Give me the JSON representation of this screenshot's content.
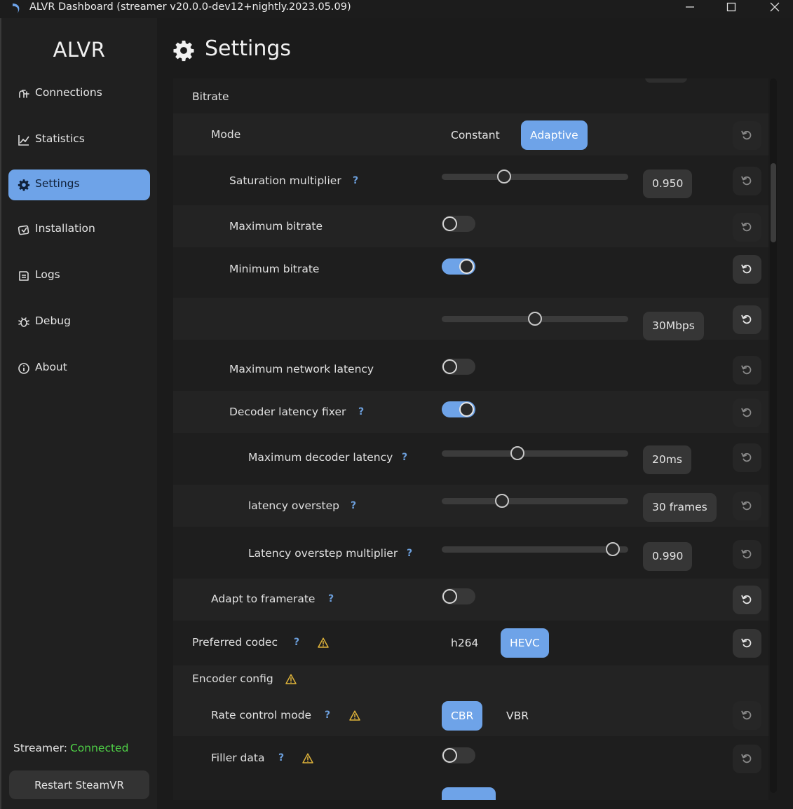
{
  "window": {
    "title": "ALVR Dashboard (streamer v20.0.0-dev12+nightly.2023.05.09)"
  },
  "sidebar": {
    "brand": "ALVR",
    "items": [
      {
        "label": "Connections",
        "icon": "connections-icon",
        "active": false
      },
      {
        "label": "Statistics",
        "icon": "chart-icon",
        "active": false
      },
      {
        "label": "Settings",
        "icon": "gear-icon",
        "active": true
      },
      {
        "label": "Installation",
        "icon": "installation-icon",
        "active": false
      },
      {
        "label": "Logs",
        "icon": "logs-icon",
        "active": false
      },
      {
        "label": "Debug",
        "icon": "debug-icon",
        "active": false
      },
      {
        "label": "About",
        "icon": "info-icon",
        "active": false
      }
    ],
    "streamer_label": "Streamer:",
    "streamer_status": "Connected",
    "restart_label": "Restart SteamVR"
  },
  "header": {
    "title": "Settings"
  },
  "colors": {
    "accent": "#6ea3e8",
    "connected": "#4fd247",
    "warning": "#e0b43a",
    "help": "#6c9fdc"
  },
  "settings": {
    "bitrate": {
      "label": "Bitrate"
    },
    "mode": {
      "label": "Mode",
      "options": [
        "Constant",
        "Adaptive"
      ],
      "selected": "Adaptive"
    },
    "saturation_multiplier": {
      "label": "Saturation multiplier",
      "help": "?",
      "value": "0.950"
    },
    "maximum_bitrate": {
      "label": "Maximum bitrate",
      "enabled": false
    },
    "minimum_bitrate": {
      "label": "Minimum bitrate",
      "enabled": true,
      "value": "30Mbps"
    },
    "maximum_network_latency": {
      "label": "Maximum network latency",
      "enabled": false
    },
    "decoder_latency_fixer": {
      "label": "Decoder latency fixer",
      "help": "?",
      "enabled": true
    },
    "maximum_decoder_latency": {
      "label": "Maximum decoder latency",
      "help": "?",
      "value": "20ms"
    },
    "latency_overstep": {
      "label": "latency overstep",
      "help": "?",
      "value": "30 frames"
    },
    "latency_overstep_multiplier": {
      "label": "Latency overstep multiplier",
      "help": "?",
      "value": "0.990"
    },
    "adapt_to_framerate": {
      "label": "Adapt to framerate",
      "help": "?",
      "enabled": false
    },
    "preferred_codec": {
      "label": "Preferred codec",
      "help": "?",
      "options": [
        "h264",
        "HEVC"
      ],
      "selected": "HEVC"
    },
    "encoder_config": {
      "label": "Encoder config"
    },
    "rate_control_mode": {
      "label": "Rate control mode",
      "help": "?",
      "options": [
        "CBR",
        "VBR"
      ],
      "selected": "CBR"
    },
    "filler_data": {
      "label": "Filler data",
      "help": "?",
      "enabled": false
    }
  },
  "sliders": {
    "saturation_multiplier": 0.32,
    "minimum_bitrate": 0.5,
    "maximum_decoder_latency": 0.4,
    "latency_overstep": 0.31,
    "latency_overstep_multiplier": 0.95
  }
}
